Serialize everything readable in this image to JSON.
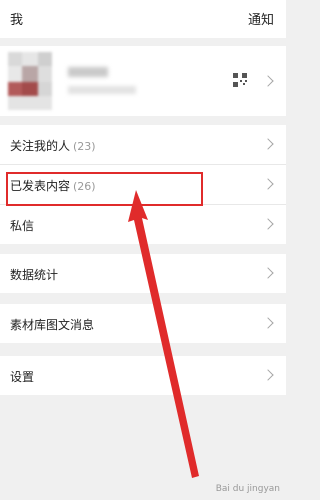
{
  "header": {
    "title": "我",
    "notice_label": "通知"
  },
  "profile": {
    "qr_icon": "qr-code-icon"
  },
  "menu_group_1": [
    {
      "label": "关注我的人",
      "count": "(23)"
    },
    {
      "label": "已发表内容",
      "count": "(26)"
    },
    {
      "label": "私信",
      "count": ""
    }
  ],
  "menu_group_2": [
    {
      "label": "数据统计"
    }
  ],
  "menu_group_3": [
    {
      "label": "素材库图文消息"
    }
  ],
  "menu_group_4": [
    {
      "label": "设置"
    }
  ],
  "annotation": {
    "highlight_color": "#e02b2b",
    "arrow_color": "#e02b2b"
  },
  "watermark": "Bai du jingyan"
}
